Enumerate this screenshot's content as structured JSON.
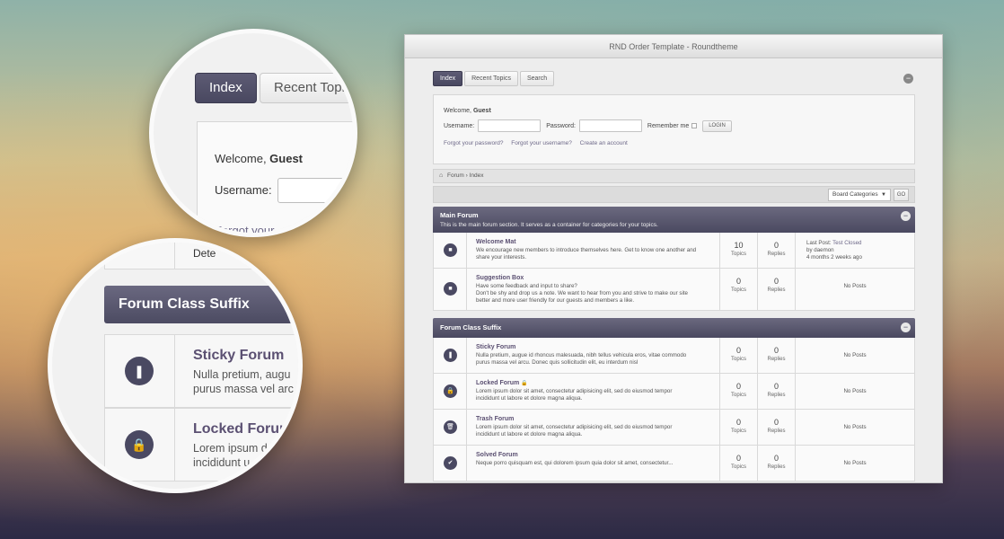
{
  "window": {
    "title": "RND Order Template - Roundtheme"
  },
  "tabs": [
    {
      "label": "Index"
    },
    {
      "label": "Recent Topics"
    },
    {
      "label": "Search"
    }
  ],
  "login": {
    "welcome_prefix": "Welcome, ",
    "welcome_user": "Guest",
    "username_label": "Username:",
    "password_label": "Password:",
    "remember_label": "Remember me",
    "login_button": "LOGIN",
    "links": [
      "Forgot your password?",
      "Forgot your username?",
      "Create an account"
    ]
  },
  "breadcrumb": {
    "items": [
      "Forum",
      "Index"
    ]
  },
  "jump": {
    "select": "Board Categories",
    "go": "GO"
  },
  "categories": [
    {
      "title": "Main Forum",
      "description": "This is the main forum section. It serves as a container for categories for your topics.",
      "forums": [
        {
          "icon": "square-icon",
          "glyph": "■",
          "name": "Welcome Mat",
          "desc1": "We encourage new members to introduce themselves here. Get to know one another and",
          "desc2": "share your interests.",
          "topics": "10",
          "replies": "0",
          "topics_label": "Topics",
          "replies_label": "Replies",
          "last_label": "Last Post:",
          "last_topic": "Test Closed",
          "last_by": "by daemon",
          "last_when": "4 months 2 weeks ago"
        },
        {
          "icon": "square-icon",
          "glyph": "■",
          "name": "Suggestion Box",
          "desc1": "Have some feedback and input to share?",
          "desc2": "Don't be shy and drop us a note. We want to hear from you and strive to make our site",
          "desc3": "better and more user friendly for our guests and members a like.",
          "topics": "0",
          "replies": "0",
          "topics_label": "Topics",
          "replies_label": "Replies",
          "no_posts": "No Posts"
        }
      ]
    },
    {
      "title": "Forum Class Suffix",
      "description": "",
      "forums": [
        {
          "icon": "bookmark-icon",
          "glyph": "❚",
          "name": "Sticky Forum",
          "desc1": "Nulla pretium, augue id rhoncus malesuada, nibh tellus vehicula eros, vitae commodo",
          "desc2": "purus massa vel arcu. Donec quis sollicitudin elit, eu interdum nisl",
          "topics": "0",
          "replies": "0",
          "topics_label": "Topics",
          "replies_label": "Replies",
          "no_posts": "No Posts"
        },
        {
          "icon": "lock-icon",
          "glyph": "🔒",
          "name": "Locked Forum",
          "name_suffix": "🔒",
          "desc1": "Lorem ipsum dolor sit amet, consectetur adipisicing elit, sed do eiusmod tempor",
          "desc2": "incididunt ut labore et dolore magna aliqua.",
          "topics": "0",
          "replies": "0",
          "topics_label": "Topics",
          "replies_label": "Replies",
          "no_posts": "No Posts"
        },
        {
          "icon": "trash-icon",
          "glyph": "🗑",
          "name": "Trash Forum",
          "desc1": "Lorem ipsum dolor sit amet, consectetur adipisicing elit, sed do eiusmod tempor",
          "desc2": "incididunt ut labore et dolore magna aliqua.",
          "topics": "0",
          "replies": "0",
          "topics_label": "Topics",
          "replies_label": "Replies",
          "no_posts": "No Posts"
        },
        {
          "icon": "check-icon",
          "glyph": "✔",
          "name": "Solved Forum",
          "desc1": "Neque porro quisquam est, qui dolorem ipsum quia dolor sit amet, consectetur...",
          "desc2": "",
          "topics": "0",
          "replies": "0",
          "topics_label": "Topics",
          "replies_label": "Replies",
          "no_posts": "No Posts"
        }
      ]
    }
  ],
  "zoom1": {
    "tab_index": "Index",
    "tab_recent": "Recent Topics",
    "welcome_prefix": "Welcome, ",
    "welcome_user": "Guest",
    "username_label": "Username:",
    "partial_link": "Forgot your"
  },
  "zoom2": {
    "top_partial": "Dete",
    "header": "Forum Class Suffix",
    "rows": [
      {
        "icon": "bookmark-icon",
        "glyph": "❚",
        "title": "Sticky Forum",
        "line1": "Nulla pretium, augu",
        "line2": "purus massa vel arc"
      },
      {
        "icon": "lock-icon",
        "glyph": "🔒",
        "title": "Locked Forum",
        "line1": "Lorem ipsum d",
        "line2": "incididunt u"
      }
    ]
  }
}
